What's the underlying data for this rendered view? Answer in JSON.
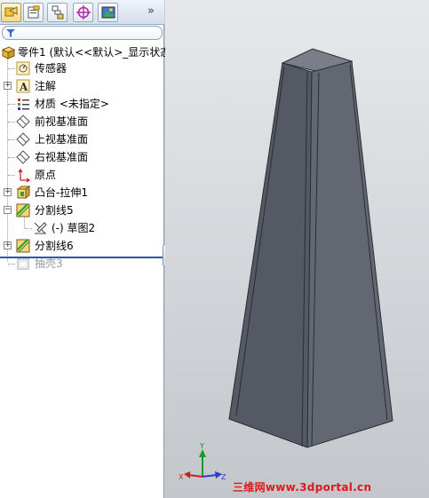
{
  "tabs": [
    {
      "name": "feature-manager",
      "active": true
    },
    {
      "name": "property-manager",
      "active": false
    },
    {
      "name": "configuration-manager",
      "active": false
    },
    {
      "name": "dimxpert-manager",
      "active": false
    },
    {
      "name": "display-manager",
      "active": false
    }
  ],
  "tab_more": "»",
  "tree": {
    "root": {
      "label": "零件1  (默认<<默认>_显示状态",
      "icon": "part-icon"
    },
    "items": [
      {
        "label": "传感器",
        "icon": "sensors-icon",
        "expandable": false
      },
      {
        "label": "注解",
        "icon": "annotations-icon",
        "expandable": true
      },
      {
        "label": "材质 <未指定>",
        "icon": "material-icon",
        "expandable": false
      },
      {
        "label": "前视基准面",
        "icon": "plane-icon",
        "expandable": false
      },
      {
        "label": "上视基准面",
        "icon": "plane-icon",
        "expandable": false
      },
      {
        "label": "右视基准面",
        "icon": "plane-icon",
        "expandable": false
      },
      {
        "label": "原点",
        "icon": "origin-icon",
        "expandable": false
      },
      {
        "label": "凸台-拉伸1",
        "icon": "extrude-icon",
        "expandable": true
      },
      {
        "label": "分割线5",
        "icon": "split-line-icon",
        "expandable": true,
        "expanded": true
      },
      {
        "label": "(-) 草图2",
        "icon": "sketch-icon",
        "expandable": false,
        "child": true
      },
      {
        "label": "分割线6",
        "icon": "split-line-icon",
        "expandable": true
      },
      {
        "label": "抽壳3",
        "icon": "shell-icon",
        "expandable": false,
        "suppressed": true
      }
    ]
  },
  "watermark": "三维网www.3dportal.cn",
  "triad": {
    "x": "X",
    "y": "Y",
    "z": "Z"
  },
  "colors": {
    "accent": "#2a57a8",
    "model_face": "#5f636e",
    "watermark": "#e01818"
  }
}
